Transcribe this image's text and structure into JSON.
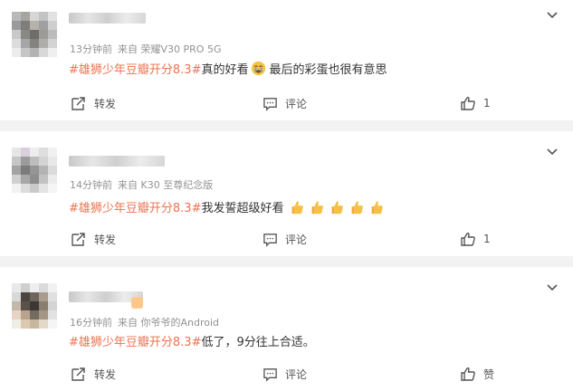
{
  "comments": [
    {
      "time": "13分钟前",
      "source": "来自 荣耀V30 PRO 5G",
      "hashtag": "#雄狮少年豆瓣开分8.3#",
      "text_before": "真的好看",
      "emoji": "crying-face-emoji",
      "text_after": "最后的彩蛋也很有意思",
      "repost_label": "转发",
      "comment_label": "评论",
      "like_label": "1"
    },
    {
      "time": "14分钟前",
      "source": "来自 K30 至尊纪念版",
      "hashtag": "#雄狮少年豆瓣开分8.3#",
      "text_before": "我发誓超级好看",
      "emoji": "thumbs-up-emoji",
      "emoji_count": 5,
      "repost_label": "转发",
      "comment_label": "评论",
      "like_label": "1"
    },
    {
      "time": "16分钟前",
      "source": "来自 你爷爷的Android",
      "hashtag": "#雄狮少年豆瓣开分8.3#",
      "text_before": "低了，9分往上合适。",
      "repost_label": "转发",
      "comment_label": "评论",
      "like_label": "赞"
    }
  ],
  "colors": {
    "hashtag": "#eb7350",
    "meta": "#939393",
    "body_text": "#333333",
    "background": "#f2f2f2",
    "card": "#ffffff"
  },
  "icons": [
    "repost-icon",
    "comment-icon",
    "like-icon",
    "chevron-down-icon",
    "avatar-blurred"
  ]
}
